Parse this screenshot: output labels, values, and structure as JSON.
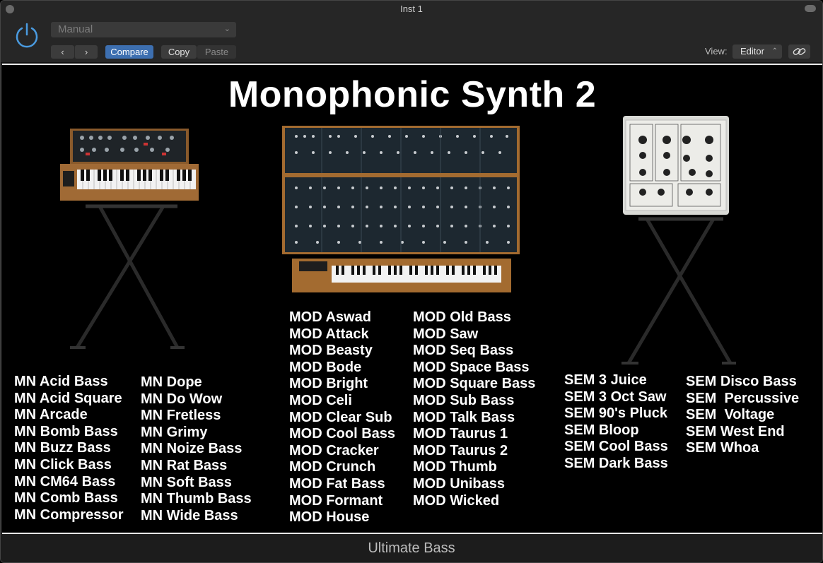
{
  "window": {
    "title": "Inst 1"
  },
  "header": {
    "preset": "Manual",
    "nav_prev": "‹",
    "nav_next": "›",
    "compare": "Compare",
    "copy": "Copy",
    "paste": "Paste",
    "view_label": "View:",
    "view_value": "Editor",
    "colors": {
      "accent": "#3d6fb0",
      "power": "#4a9be0"
    }
  },
  "panel": {
    "title": "Monophonic Synth 2",
    "mn_col1": [
      "MN Acid Bass",
      "MN Acid Square",
      "MN Arcade",
      "MN Bomb Bass",
      "MN Buzz Bass",
      "MN Click Bass",
      "MN CM64 Bass",
      "MN Comb Bass",
      "MN Compressor"
    ],
    "mn_col2": [
      "MN Dope",
      "MN Do Wow",
      "MN Fretless",
      "MN Grimy",
      "MN Noize Bass",
      "MN Rat Bass",
      "MN Soft Bass",
      "MN Thumb Bass",
      "MN Wide Bass"
    ],
    "mod_col1": [
      "MOD Aswad",
      "MOD Attack",
      "MOD Beasty",
      "MOD Bode",
      "MOD Bright",
      "MOD Celi",
      "MOD Clear Sub",
      "MOD Cool Bass",
      "MOD Cracker",
      "MOD Crunch",
      "MOD Fat Bass",
      "MOD Formant",
      "MOD House"
    ],
    "mod_col2": [
      "MOD Old Bass",
      "MOD Saw",
      "MOD Seq Bass",
      "MOD Space Bass",
      "MOD Square Bass",
      "MOD Sub Bass",
      "MOD Talk Bass",
      "MOD Taurus 1",
      "MOD Taurus 2",
      "MOD Thumb",
      "MOD Unibass",
      "MOD Wicked"
    ],
    "sem_col1": [
      "SEM 3 Juice",
      "SEM 3 Oct Saw",
      "SEM 90's Pluck",
      "SEM Bloop",
      "SEM Cool Bass",
      "SEM Dark Bass"
    ],
    "sem_col2": [
      "SEM Disco Bass",
      "SEM  Percussive",
      "SEM  Voltage",
      "SEM West End",
      "SEM Whoa"
    ]
  },
  "footer": {
    "title": "Ultimate Bass"
  }
}
